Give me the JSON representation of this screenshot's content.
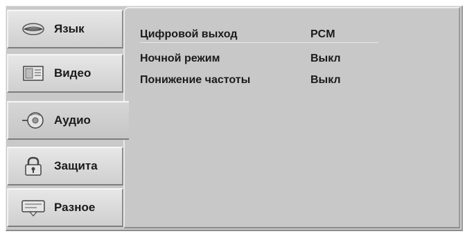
{
  "sidebar": {
    "tabs": [
      {
        "label": "Язык",
        "icon": "lips-icon"
      },
      {
        "label": "Видео",
        "icon": "video-icon"
      },
      {
        "label": "Аудио",
        "icon": "audio-icon"
      },
      {
        "label": "Защита",
        "icon": "lock-icon"
      },
      {
        "label": "Разное",
        "icon": "message-icon"
      }
    ],
    "active_index": 2
  },
  "audio_settings": {
    "rows": [
      {
        "name": "Цифровой выход",
        "value": "PCM"
      },
      {
        "name": "Ночной режим",
        "value": "Выкл"
      },
      {
        "name": "Понижение частоты",
        "value": "Выкл"
      }
    ]
  }
}
